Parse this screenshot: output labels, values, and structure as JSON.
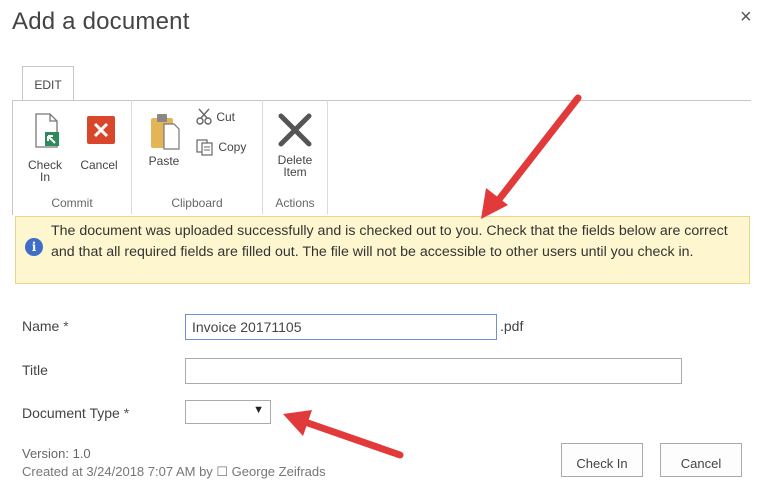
{
  "dialog": {
    "title": "Add a document",
    "close_glyph": "×"
  },
  "ribbon": {
    "tab_label": "EDIT",
    "groups": {
      "commit": {
        "label": "Commit",
        "check_in": [
          "Check",
          "In"
        ],
        "cancel": "Cancel"
      },
      "clipboard": {
        "label": "Clipboard",
        "paste": "Paste",
        "cut": "Cut",
        "copy": "Copy"
      },
      "actions": {
        "label": "Actions",
        "delete_item": [
          "Delete",
          "Item"
        ]
      }
    }
  },
  "notice": {
    "icon": "i",
    "text": "The document was uploaded successfully and is checked out to you. Check that the fields below are correct and that all required fields are filled out. The file will not be accessible to other users until you check in."
  },
  "form": {
    "name": {
      "label": "Name",
      "required_mark": "*",
      "value": "Invoice 20171105",
      "suffix": ".pdf"
    },
    "title": {
      "label": "Title",
      "value": ""
    },
    "document_type": {
      "label": "Document Type",
      "required_mark": "*",
      "selected": "",
      "caret": "▼"
    }
  },
  "footer": {
    "version": "Version: 1.0",
    "cut_line": "Created at 3/24/2018 7:07 AM by  ☐  George Zeifrads",
    "check_in_button": "Check In",
    "cancel_button": "Cancel"
  },
  "colors": {
    "notice_background": "#fdf6cf",
    "annotation_arrow": "#e23a3a",
    "cancel_icon": "#d9472b",
    "info_icon": "#3f6ec8"
  }
}
